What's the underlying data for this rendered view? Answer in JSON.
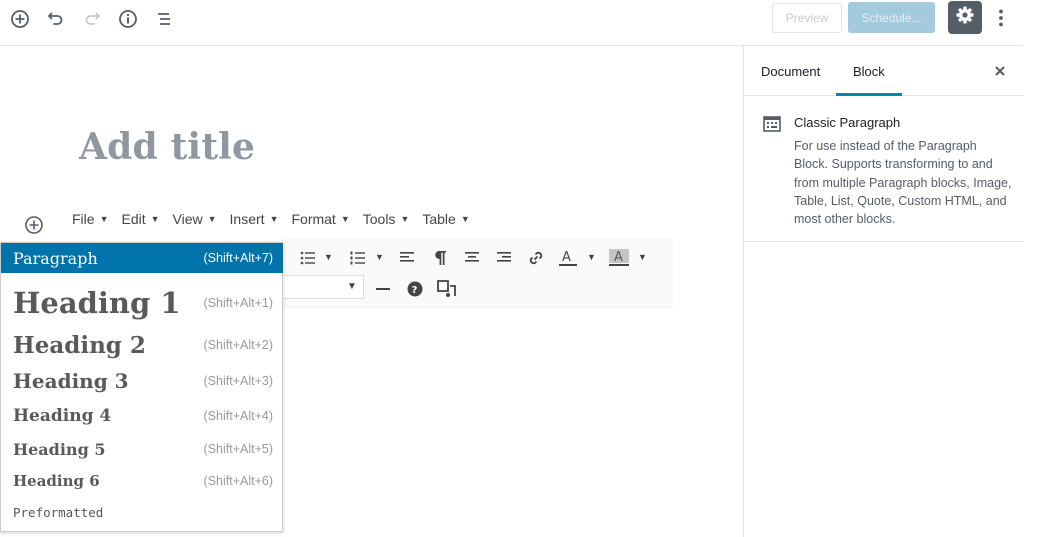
{
  "header": {
    "icons": {
      "add": "plus-circle-icon",
      "undo": "undo-icon",
      "redo": "redo-icon",
      "info": "info-icon",
      "outline": "list-view-icon",
      "settings": "gear-icon",
      "more": "vertical-ellipsis-icon"
    },
    "preview_label": "Preview",
    "schedule_label": "Schedule..."
  },
  "editor": {
    "title_placeholder": "Add title",
    "menubar": [
      "File",
      "Edit",
      "View",
      "Insert",
      "Format",
      "Tools",
      "Table"
    ],
    "format_dropdown": [
      {
        "label": "Paragraph",
        "shortcut": "(Shift+Alt+7)",
        "selected": true
      },
      {
        "label": "Heading 1",
        "shortcut": "(Shift+Alt+1)"
      },
      {
        "label": "Heading 2",
        "shortcut": "(Shift+Alt+2)"
      },
      {
        "label": "Heading 3",
        "shortcut": "(Shift+Alt+3)"
      },
      {
        "label": "Heading 4",
        "shortcut": "(Shift+Alt+4)"
      },
      {
        "label": "Heading 5",
        "shortcut": "(Shift+Alt+5)"
      },
      {
        "label": "Heading 6",
        "shortcut": "(Shift+Alt+6)"
      },
      {
        "label": "Preformatted",
        "shortcut": ""
      }
    ],
    "toolbar_icons": [
      "bullet-list-icon",
      "numbered-list-icon",
      "align-left-icon",
      "paragraph-icon",
      "align-center-icon",
      "align-right-icon",
      "link-icon",
      "text-color-icon",
      "background-color-icon",
      "horizontal-line-icon",
      "help-icon",
      "special-character-icon"
    ]
  },
  "sidebar": {
    "tabs": [
      "Document",
      "Block"
    ],
    "active_tab": "Block",
    "block": {
      "icon": "classic-block-icon",
      "title": "Classic Paragraph",
      "description": "For use instead of the Paragraph Block. Supports transforming to and from multiple Paragraph blocks, Image, Table, List, Quote, Custom HTML, and most other blocks."
    }
  },
  "colors": {
    "accent": "#0085ba",
    "selected": "#0073aa",
    "settings_bg": "#555d66",
    "schedule_bg": "#a3cbdd"
  }
}
